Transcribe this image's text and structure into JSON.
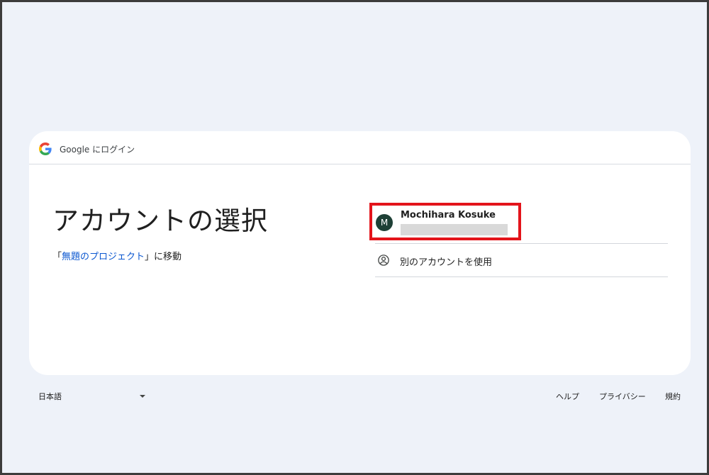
{
  "header": {
    "title": "Google にログイン",
    "logo_icon": "google-g-logo"
  },
  "main": {
    "heading": "アカウントの選択",
    "continue_prefix": "「",
    "continue_link": "無題のプロジェクト",
    "continue_suffix": "」に移動"
  },
  "accounts": [
    {
      "initial": "M",
      "name": "Mochihara Kosuke",
      "avatar_color": "#1e4036"
    }
  ],
  "other_account": {
    "label": "別のアカウントを使用",
    "icon": "account-circle-icon"
  },
  "footer": {
    "language": "日本語",
    "links": [
      "ヘルプ",
      "プライバシー",
      "規約"
    ]
  },
  "colors": {
    "background": "#eef2f9",
    "link": "#0b57d0",
    "highlight": "#e3141b"
  }
}
